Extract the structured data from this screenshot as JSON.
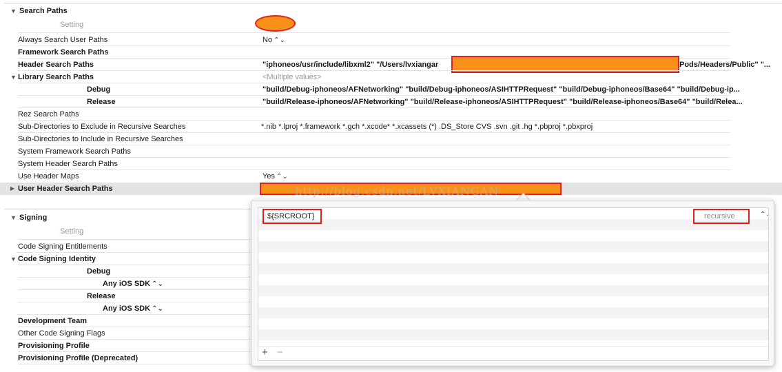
{
  "search_paths": {
    "section_title": "Search Paths",
    "setting_header": "Setting",
    "rows": {
      "always_search_user_paths": {
        "name": "Always Search User Paths",
        "value": "No"
      },
      "framework_search_paths": {
        "name": "Framework Search Paths"
      },
      "header_search_paths": {
        "name": "Header Search Paths",
        "value_start": "\"iphoneos/usr/include/libxml2\"  \"/Users/lvxiangar",
        "value_end": "Pods/Headers/Public\" \"..."
      },
      "library_search_paths": {
        "name": "Library Search Paths",
        "value": "<Multiple values>"
      },
      "library_debug": {
        "name": "Debug",
        "value": "\"build/Debug-iphoneos/AFNetworking\" \"build/Debug-iphoneos/ASIHTTPRequest\" \"build/Debug-iphoneos/Base64\" \"build/Debug-ip..."
      },
      "library_release": {
        "name": "Release",
        "value": "\"build/Release-iphoneos/AFNetworking\" \"build/Release-iphoneos/ASIHTTPRequest\" \"build/Release-iphoneos/Base64\" \"build/Relea..."
      },
      "rez_search_paths": {
        "name": "Rez Search Paths"
      },
      "subdirs_exclude": {
        "name": "Sub-Directories to Exclude in Recursive Searches",
        "value": "*.nib *.lproj *.framework *.gch *.xcode* *.xcassets (*) .DS_Store CVS .svn .git .hg *.pbproj *.pbxproj"
      },
      "subdirs_include": {
        "name": "Sub-Directories to Include in Recursive Searches"
      },
      "system_framework_search_paths": {
        "name": "System Framework Search Paths"
      },
      "system_header_search_paths": {
        "name": "System Header Search Paths"
      },
      "use_header_maps": {
        "name": "Use Header Maps",
        "value": "Yes"
      },
      "user_header_search_paths": {
        "name": "User Header Search Paths"
      }
    }
  },
  "signing": {
    "section_title": "Signing",
    "setting_header": "Setting",
    "rows": {
      "code_signing_entitlements": {
        "name": "Code Signing Entitlements"
      },
      "code_signing_identity": {
        "name": "Code Signing Identity"
      },
      "debug": {
        "name": "Debug"
      },
      "debug_sdk": {
        "name": "Any iOS SDK"
      },
      "release": {
        "name": "Release"
      },
      "release_sdk": {
        "name": "Any iOS SDK"
      },
      "development_team": {
        "name": "Development Team"
      },
      "other_code_signing_flags": {
        "name": "Other Code Signing Flags"
      },
      "provisioning_profile": {
        "name": "Provisioning Profile"
      },
      "provisioning_profile_deprecated": {
        "name": "Provisioning Profile (Deprecated)"
      }
    }
  },
  "popover": {
    "path_value": "${SRCROOT}",
    "recursion_option": "recursive",
    "add_label": "+",
    "remove_label": "−"
  },
  "watermark": "http://blog.csdn.net/LVXIANGAN",
  "icons": {
    "disclosure_open": "▼",
    "disclosure_closed": "▶",
    "stepper": "⌃⌄"
  },
  "colors": {
    "redaction_fill": "#f99019",
    "annotation_border": "#e02020"
  }
}
